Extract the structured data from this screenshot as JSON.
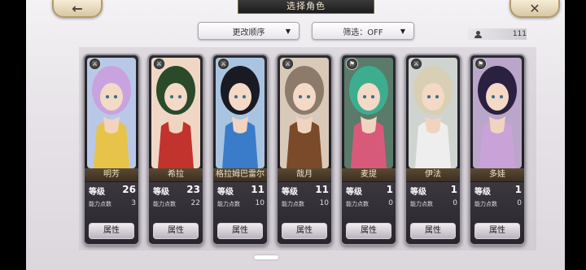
{
  "header": {
    "title": "选择角色",
    "back_icon": "arrow-left-icon",
    "close_icon": "close-x-icon"
  },
  "controls": {
    "sort_label": "更改顺序",
    "filter_label": "筛选：OFF",
    "character_count": "111"
  },
  "labels": {
    "level": "等级",
    "points": "能力点数",
    "attribute_button": "属性"
  },
  "characters": [
    {
      "name": "明芳",
      "level": "26",
      "points": "3",
      "hair": "#c9a3e0",
      "outfit": "#e8c34a",
      "bg": "#b9c8e6"
    },
    {
      "name": "希拉",
      "level": "23",
      "points": "22",
      "hair": "#2a4a2a",
      "outfit": "#c2332e",
      "bg": "#f0d7c5"
    },
    {
      "name": "格拉姆巴雷尔",
      "level": "11",
      "points": "10",
      "hair": "#1a1a22",
      "outfit": "#3a7cc9",
      "bg": "#a8c4e0"
    },
    {
      "name": "哉月",
      "level": "11",
      "points": "10",
      "hair": "#8c7a6a",
      "outfit": "#7a4a2a",
      "bg": "#d9c9b8"
    },
    {
      "name": "麦提",
      "level": "1",
      "points": "0",
      "hair": "#3cae8f",
      "outfit": "#d85a7a",
      "bg": "#5a7a6a"
    },
    {
      "name": "伊法",
      "level": "1",
      "points": "0",
      "hair": "#d8cfb5",
      "outfit": "#eeeeee",
      "bg": "#cfd4d0"
    },
    {
      "name": "多娃",
      "level": "1",
      "points": "0",
      "hair": "#2a2040",
      "outfit": "#c9a3d8",
      "bg": "#b9a6c8"
    }
  ]
}
